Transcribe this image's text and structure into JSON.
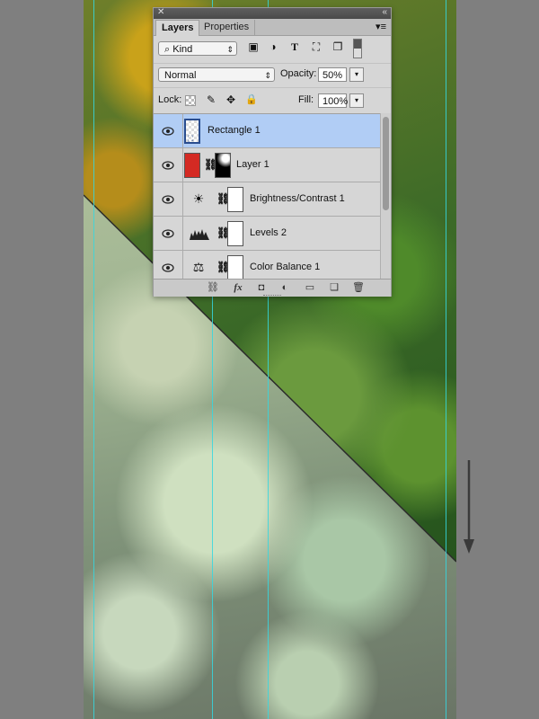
{
  "panel": {
    "tabs": [
      {
        "label": "Layers"
      },
      {
        "label": "Properties"
      }
    ],
    "filter": {
      "value": "Kind"
    },
    "blend_mode": {
      "value": "Normal"
    },
    "opacity": {
      "label": "Opacity:",
      "value": "50%"
    },
    "lock": {
      "label": "Lock:"
    },
    "fill": {
      "label": "Fill:",
      "value": "100%"
    },
    "layers": [
      {
        "name": "Rectangle 1",
        "selected": true,
        "visible": true
      },
      {
        "name": "Layer 1",
        "selected": false,
        "visible": true
      },
      {
        "name": "Brightness/Contrast 1",
        "selected": false,
        "visible": true
      },
      {
        "name": "Levels 2",
        "selected": false,
        "visible": true
      },
      {
        "name": "Color Balance 1",
        "selected": false,
        "visible": true
      }
    ]
  },
  "colors": {
    "selection": "#b1cdf5",
    "layer1_thumb": "#d42a23",
    "guides": "#35d7e0"
  },
  "icons": {
    "filter": [
      "image-filter-icon",
      "adjustment-filter-icon",
      "type-filter-icon",
      "shape-filter-icon",
      "smart-object-filter-icon",
      "filter-toggle-icon"
    ],
    "lock": [
      "lock-transparent-icon",
      "lock-paint-icon",
      "lock-position-icon",
      "lock-all-icon"
    ],
    "footer": [
      "link-layers-icon",
      "fx-icon",
      "add-mask-icon",
      "new-adjustment-icon",
      "new-group-icon",
      "new-layer-icon",
      "delete-layer-icon"
    ]
  }
}
